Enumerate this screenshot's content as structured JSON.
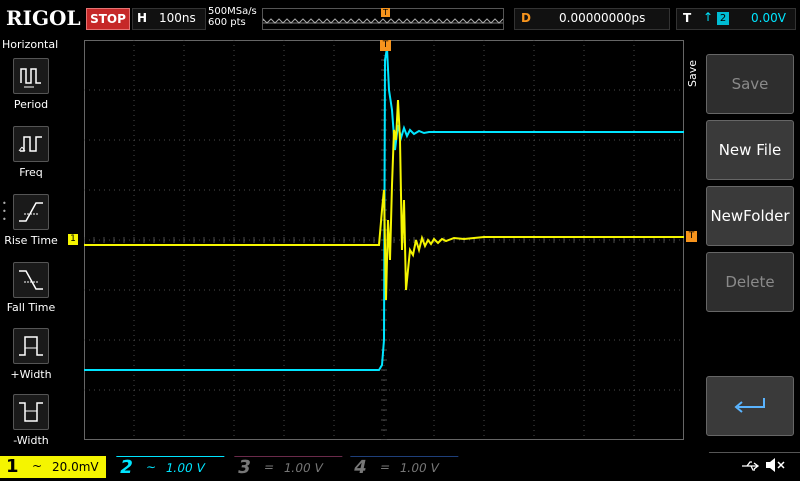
{
  "brand": {
    "logo": "RIGOL"
  },
  "status": {
    "run_state": "STOP"
  },
  "horizontal": {
    "key": "H",
    "timebase": "100ns",
    "sample_rate": "500MSa/s",
    "points": "600  pts"
  },
  "delay": {
    "key": "D",
    "value": "0.00000000ps"
  },
  "trigger": {
    "key": "T",
    "edge_icon": "rising-edge-icon",
    "source": "2",
    "level": "0.00V",
    "marker": "T"
  },
  "left_menu": {
    "title": "Horizontal",
    "items": [
      {
        "label": "Period",
        "icon": "period-icon"
      },
      {
        "label": "Freq",
        "icon": "frequency-icon"
      },
      {
        "label": "Rise Time",
        "icon": "rise-time-icon"
      },
      {
        "label": "Fall Time",
        "icon": "fall-time-icon"
      },
      {
        "label": "+Width",
        "icon": "positive-width-icon"
      },
      {
        "label": "-Width",
        "icon": "negative-width-icon"
      }
    ]
  },
  "right_menu": {
    "title": "Save",
    "buttons": [
      {
        "label": "Save",
        "enabled": false
      },
      {
        "label": "New File",
        "enabled": true
      },
      {
        "label": "NewFolder",
        "enabled": true
      },
      {
        "label": "Delete",
        "enabled": false
      }
    ],
    "back_icon": "return-arrow-icon"
  },
  "channels": [
    {
      "number": "1",
      "coupling": "~",
      "scale": "20.0mV",
      "color": "#f5f500",
      "active": true
    },
    {
      "number": "2",
      "coupling": "~",
      "scale": "1.00 V",
      "color": "#00e5ff",
      "active": true
    },
    {
      "number": "3",
      "coupling": "=",
      "scale": "1.00 V",
      "color": "#ff3fa0",
      "active": false
    },
    {
      "number": "4",
      "coupling": "=",
      "scale": "1.00 V",
      "color": "#2979ff",
      "active": false
    }
  ],
  "markers": {
    "ch1_marker": "1",
    "trig_level_marker": "T"
  },
  "status_icons": [
    "usb-icon",
    "mute-icon"
  ],
  "colors": {
    "ch1": "#f5f500",
    "ch2": "#00e5ff",
    "trigger": "#f7941d",
    "grid": "#4a4a4a"
  }
}
